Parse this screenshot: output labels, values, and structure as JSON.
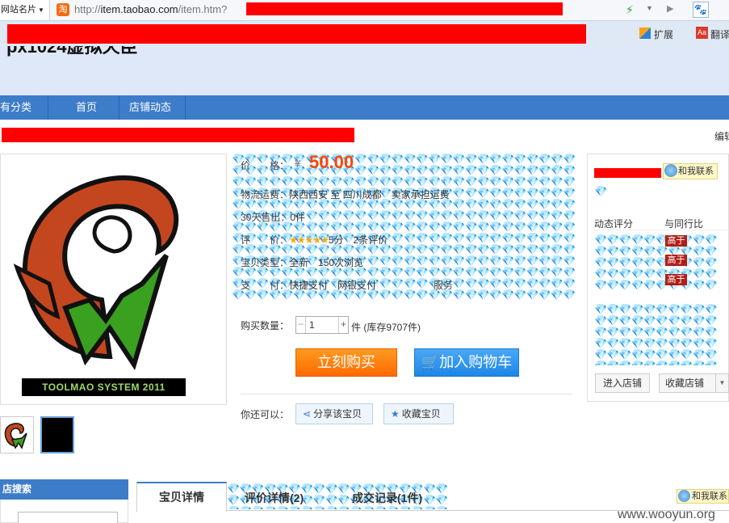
{
  "browser": {
    "site_card_label": "网站名片",
    "url_domain": "item.taobao.com",
    "url_prefix": "http://",
    "url_suffix": "/item.htm?",
    "ext_label": "扩展",
    "translate_label": "翻译",
    "tao_icon_char": "淘"
  },
  "shop": {
    "title": "px1024虚拟天臣",
    "nav": [
      "有分类",
      "首页",
      "店铺动态"
    ],
    "edit_label": "编辑"
  },
  "product": {
    "logo_caption": "TOOLMAO SYSTEM 2011",
    "price_label": "价　　格：",
    "price_symbol": "¥",
    "price": "50.00",
    "shipping_label": "物流运费：",
    "shipping_value": "陕西西安 至 四川成都　卖家承担运费",
    "sold_label": "30天售出：",
    "sold_value": "0件",
    "rating_label": "评　　价：",
    "rating_stars": "★★★★★",
    "rating_value": "5分　2条评价",
    "type_label": "宝贝类型：",
    "type_value": "全新　150次浏览",
    "pay_label": "支　　付：",
    "pay_value": "快捷支付　网银支付",
    "service_label": "服务",
    "quantity_label": "购买数量：",
    "quantity_value": "1",
    "stock_text": "件 (库存9707件)",
    "buy_now_label": "立刻购买",
    "add_cart_label": "加入购物车",
    "also_label": "你还可以：",
    "share_label": "分享该宝贝",
    "favorite_label": "收藏宝贝"
  },
  "seller": {
    "contact_label": "和我联系",
    "rating_header": "动态评分",
    "compare_header": "与同行比",
    "badges": [
      "高于",
      "高于",
      "高于"
    ],
    "enter_shop_label": "进入店铺",
    "favorite_shop_label": "收藏店铺"
  },
  "bottom": {
    "search_header": "店搜索",
    "tabs": [
      "宝贝详情",
      "评价详情(2)",
      "成交记录(1件)"
    ],
    "contact_label": "和我联系"
  },
  "watermark": "www.wooyun.org",
  "colors": {
    "nav_bg": "#3d7cc9",
    "price": "#ff4400",
    "buy_now": "#ff7a00",
    "add_cart": "#2b8ff0",
    "badge": "#b21e16",
    "redaction": "#ff0000",
    "diamond_overlay": "#1f8fd0"
  },
  "icons": [
    "bolt-icon",
    "dropdown-icon",
    "play-icon",
    "paw-icon",
    "extension-icon",
    "translate-icon",
    "cart-icon",
    "share-icon",
    "star-icon",
    "contact-face-icon"
  ]
}
